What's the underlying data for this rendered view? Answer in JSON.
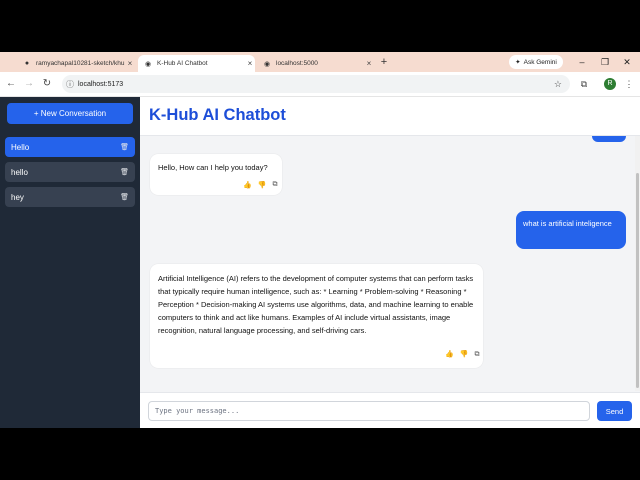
{
  "browser": {
    "tabs": [
      {
        "label": "ramyachapal10281-sketch/khu"
      },
      {
        "label": "K-Hub AI Chatbot"
      },
      {
        "label": "localhost:5000"
      }
    ],
    "new_tab": "+",
    "ask_gemini": "Ask Gemini",
    "url": "localhost:5173",
    "profile_initial": "R",
    "icons": [
      "github-icon",
      "back-icon",
      "forward-icon",
      "reload-icon",
      "star-icon",
      "extensions-icon",
      "minimize-icon",
      "maximize-icon",
      "close-icon"
    ]
  },
  "sidebar": {
    "new_conversation": "+ New Conversation",
    "conversations": [
      {
        "name": "Hello",
        "active": true
      },
      {
        "name": "hello",
        "active": false
      },
      {
        "name": "hey",
        "active": false
      }
    ]
  },
  "header": {
    "title": "K-Hub AI Chatbot"
  },
  "messages": [
    {
      "role": "bot",
      "text": "Hello, How can I help you today?"
    },
    {
      "role": "user",
      "text": "what is artificial inteligence"
    },
    {
      "role": "bot",
      "text": "Artificial Intelligence (AI) refers to the development of computer systems that can perform tasks that typically require human intelligence, such as: * Learning * Problem-solving * Reasoning * Perception * Decision-making AI systems use algorithms, data, and machine learning to enable computers to think and act like humans. Examples of AI include virtual assistants, image recognition, natural language processing, and self-driving cars."
    }
  ],
  "composer": {
    "placeholder": "Type your message...",
    "send": "Send"
  },
  "colors": {
    "accent": "#2563eb",
    "sidebar": "#1f2937",
    "title": "#1d4ed8"
  }
}
